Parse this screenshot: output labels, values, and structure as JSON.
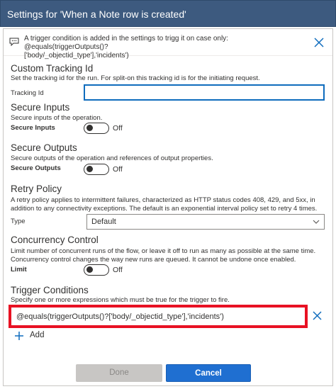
{
  "header": {
    "title": "Settings for 'When a Note row is created'"
  },
  "info_bar": {
    "text_line1": "A trigger condition is added in the settings to trigg it on case only: @equals(triggerOutputs()?",
    "text_line2": "['body/_objectid_type'],'incidents')"
  },
  "tracking": {
    "title": "Custom Tracking Id",
    "description": "Set the tracking id for the run. For split-on this tracking id is for the initiating request.",
    "field_label": "Tracking Id",
    "value": ""
  },
  "secure_inputs": {
    "title": "Secure Inputs",
    "description": "Secure inputs of the operation.",
    "field_label": "Secure Inputs",
    "state": "Off"
  },
  "secure_outputs": {
    "title": "Secure Outputs",
    "description": "Secure outputs of the operation and references of output properties.",
    "field_label": "Secure Outputs",
    "state": "Off"
  },
  "retry": {
    "title": "Retry Policy",
    "description_line1": "A retry policy applies to intermittent failures, characterized as HTTP status codes 408, 429, and 5xx, in",
    "description_line2": "addition to any connectivity exceptions. The default is an exponential interval policy set to retry 4 times.",
    "field_label": "Type",
    "selected": "Default"
  },
  "concurrency": {
    "title": "Concurrency Control",
    "description_line1": "Limit number of concurrent runs of the flow, or leave it off to run as many as possible at the same time.",
    "description_line2": "Concurrency control changes the way new runs are queued. It cannot be undone once enabled.",
    "field_label": "Limit",
    "state": "Off"
  },
  "trigger_conditions": {
    "title": "Trigger Conditions",
    "description": "Specify one or more expressions which must be true for the trigger to fire.",
    "condition": "@equals(triggerOutputs()?['body/_objectid_type'],'incidents')",
    "add_label": "Add"
  },
  "footer": {
    "done_label": "Done",
    "cancel_label": "Cancel"
  },
  "colors": {
    "header_bg": "#3d5a7f",
    "accent": "#1f6fd1",
    "highlight": "#e81123"
  },
  "icons": {
    "info": "comment-icon",
    "close": "close-icon",
    "chevron": "chevron-down-icon",
    "add": "plus-icon"
  }
}
